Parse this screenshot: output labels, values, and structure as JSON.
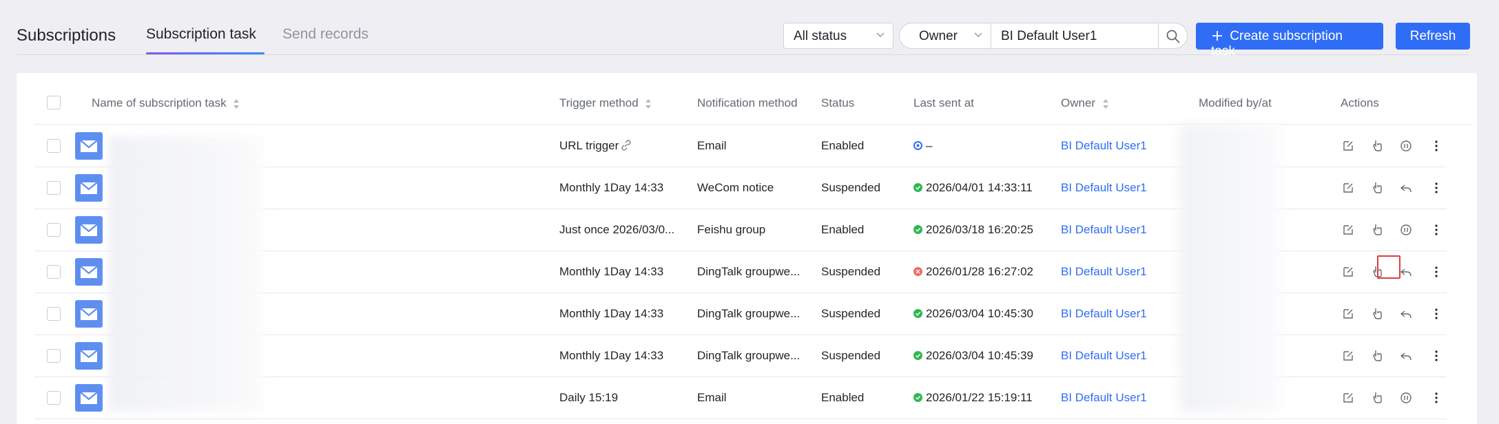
{
  "header": {
    "title": "Subscriptions",
    "tabs": [
      {
        "label": "Subscription task",
        "active": true
      },
      {
        "label": "Send records",
        "active": false
      }
    ],
    "status_select": "All status",
    "owner_field": "Owner",
    "owner_value": "BI Default User1",
    "create_button": "Create subscription task",
    "refresh_button": "Refresh"
  },
  "table": {
    "columns": {
      "name": "Name of subscription task",
      "trigger": "Trigger method",
      "notify": "Notification method",
      "status": "Status",
      "last_sent": "Last sent at",
      "owner": "Owner",
      "modified": "Modified by/at",
      "actions": "Actions"
    },
    "rows": [
      {
        "trigger": "URL trigger",
        "notify": "Email",
        "status": "Enabled",
        "last_sent": "–",
        "last_state": "url",
        "owner": "BI Default User1",
        "third_action": "pause"
      },
      {
        "trigger": "Monthly 1Day 14:33",
        "notify": "WeCom notice",
        "status": "Suspended",
        "last_sent": "2026/04/01 14:33:11",
        "last_state": "ok",
        "owner": "BI Default User1",
        "third_action": "resume"
      },
      {
        "trigger": "Just once 2026/03/0...",
        "notify": "Feishu group",
        "status": "Enabled",
        "last_sent": "2026/03/18 16:20:25",
        "last_state": "ok",
        "owner": "BI Default User1",
        "third_action": "pause"
      },
      {
        "trigger": "Monthly 1Day 14:33",
        "notify": "DingTalk groupwe...",
        "status": "Suspended",
        "last_sent": "2026/01/28 16:27:02",
        "last_state": "err",
        "owner": "BI Default User1",
        "third_action": "resume"
      },
      {
        "trigger": "Monthly 1Day 14:33",
        "notify": "DingTalk groupwe...",
        "status": "Suspended",
        "last_sent": "2026/03/04 10:45:30",
        "last_state": "ok",
        "owner": "BI Default User1",
        "third_action": "resume"
      },
      {
        "trigger": "Monthly 1Day 14:33",
        "notify": "DingTalk groupwe...",
        "status": "Suspended",
        "last_sent": "2026/03/04 10:45:39",
        "last_state": "ok",
        "owner": "BI Default User1",
        "third_action": "resume"
      },
      {
        "trigger": "Daily 15:19",
        "notify": "Email",
        "status": "Enabled",
        "last_sent": "2026/01/22 15:19:11",
        "last_state": "ok",
        "owner": "BI Default User1",
        "third_action": "pause"
      }
    ]
  },
  "colors": {
    "accent": "#2f6df6",
    "success": "#2fb84f",
    "error": "#f06a67",
    "highlight": "#e03c3c"
  }
}
